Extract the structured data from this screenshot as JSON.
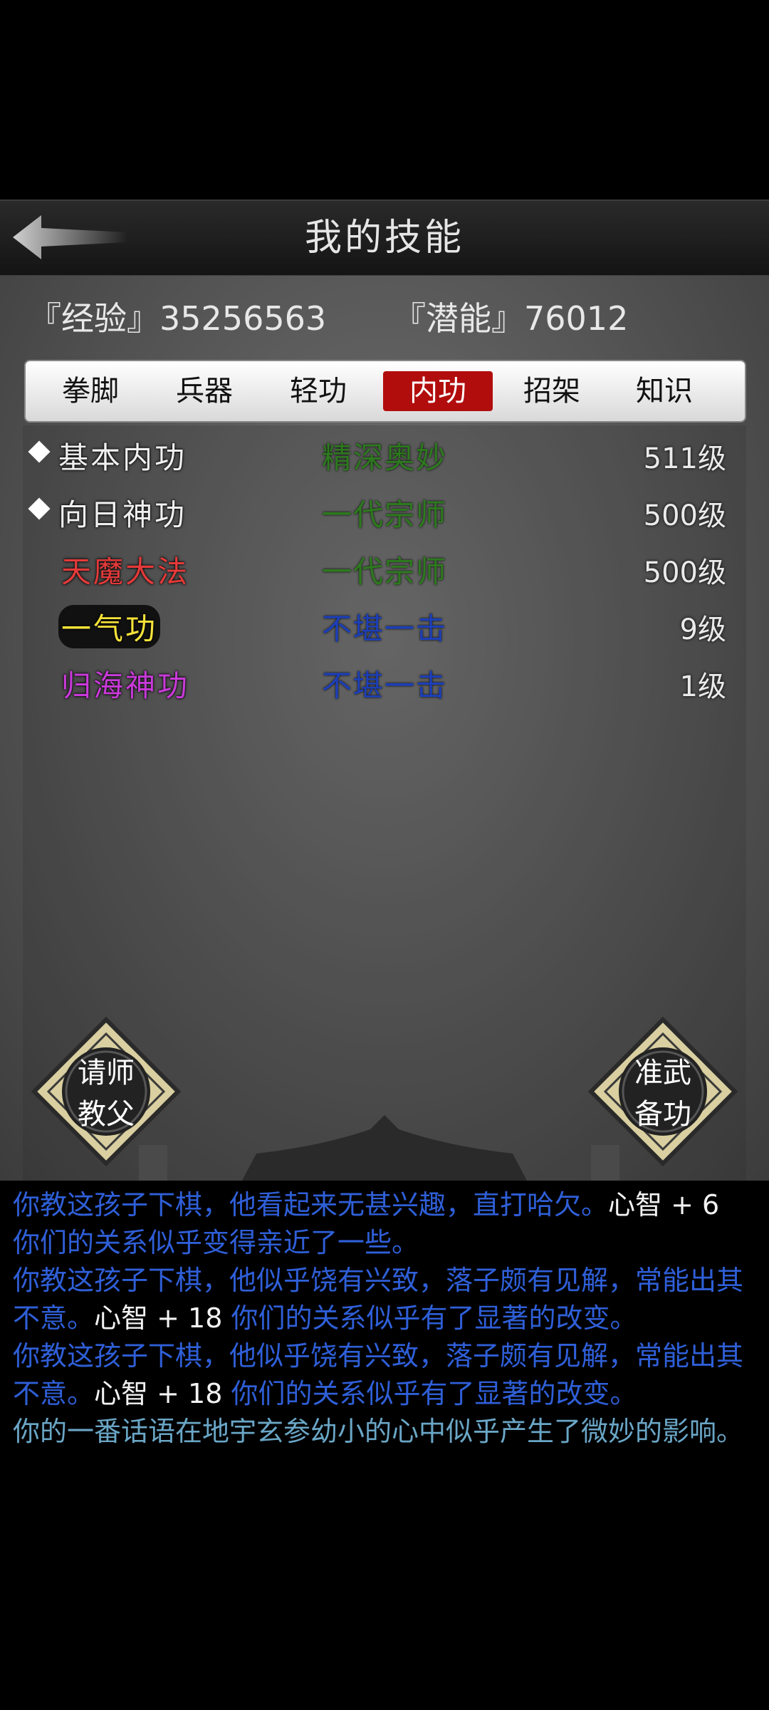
{
  "header": {
    "title": "我的技能"
  },
  "stats": {
    "exp_label": "『经验』35256563",
    "pot_label": "『潜能』76012"
  },
  "tabs": [
    "拳脚",
    "兵器",
    "轻功",
    "内功",
    "招架",
    "知识"
  ],
  "active_tab": "内功",
  "skills": [
    {
      "name": "基本内功",
      "grade": "精深奥妙",
      "level": "511级",
      "name_color": "#f0f0f0",
      "grade_color": "#2d7a1e",
      "marker": true
    },
    {
      "name": "向日神功",
      "grade": "一代宗师",
      "level": "500级",
      "name_color": "#f0f0f0",
      "grade_color": "#2d7a1e",
      "marker": true
    },
    {
      "name": "天魔大法",
      "grade": "一代宗师",
      "level": "500级",
      "name_color": "#e43a3a",
      "grade_color": "#2d7a1e",
      "marker": false
    },
    {
      "name": "一气功",
      "grade": "不堪一击",
      "level": "9级",
      "name_color": "#f4e23a",
      "grade_color": "#1c3fb8",
      "marker": false
    },
    {
      "name": "归海神功",
      "grade": "不堪一击",
      "level": "1级",
      "name_color": "#c83ad8",
      "grade_color": "#1c3fb8",
      "marker": false
    }
  ],
  "buttons": {
    "teach_line1": "请师",
    "teach_line2": "教父",
    "prepare_line1": "准武",
    "prepare_line2": "备功"
  },
  "log": {
    "l1a": "你教这孩子下棋，他看起来无甚兴趣，直打哈欠。",
    "l1b": "心智 + 6",
    "l1c": " 你们的关系似乎变得亲近了一些。",
    "l2a": "你教这孩子下棋，他似乎饶有兴致，落子颇有见解，常能出其不意。",
    "l2b": "心智 + 18",
    "l2c": " 你们的关系似乎有了显著的改变。",
    "l3a": "你教这孩子下棋，他似乎饶有兴致，落子颇有见解，常能出其不意。",
    "l3b": "心智 + 18",
    "l3c": " 你们的关系似乎有了显著的改变。",
    "l4": "你的一番话语在地宇玄参幼小的心中似乎产生了微妙的影响。"
  }
}
